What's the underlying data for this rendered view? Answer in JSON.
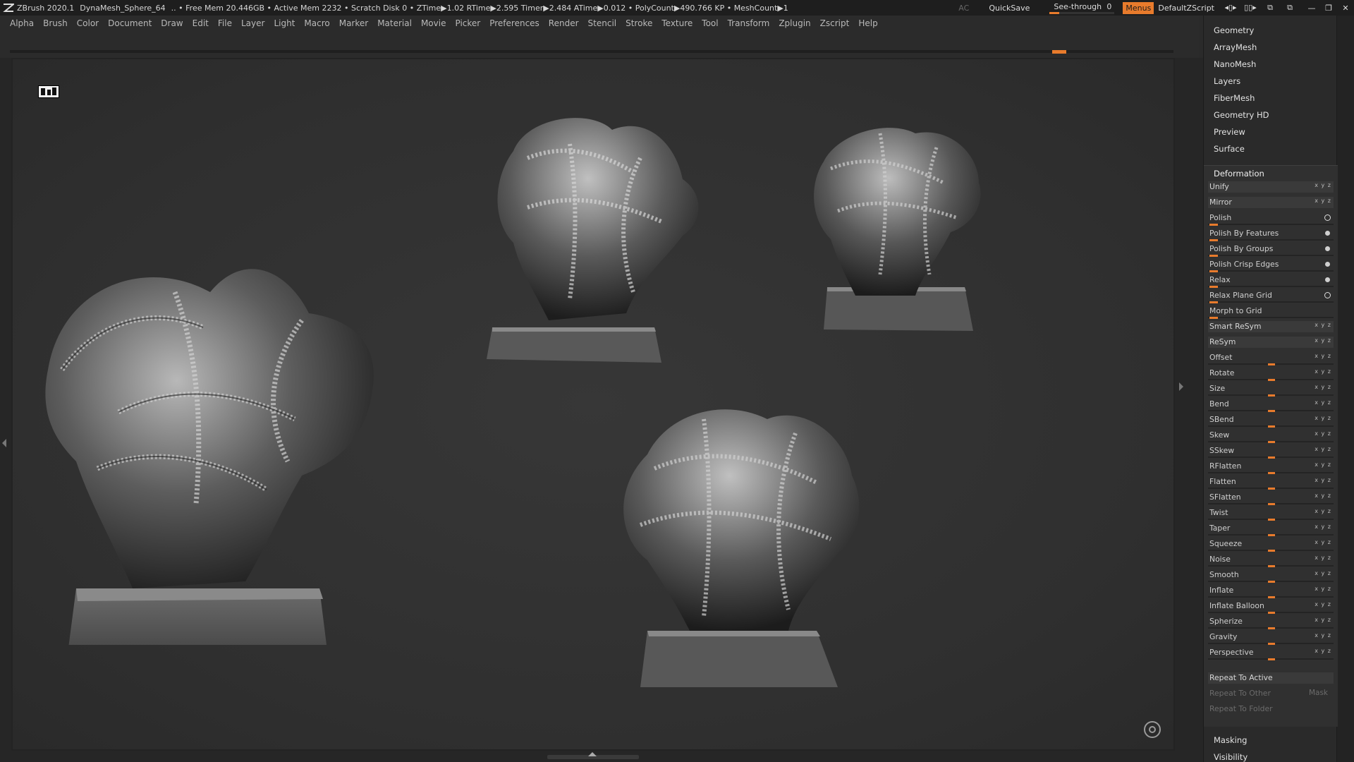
{
  "titlebar": {
    "app": "ZBrush 2020.1",
    "document": "DynaMesh_Sphere_64",
    "stats": ".. • Free Mem 20.446GB • Active Mem 2232 • Scratch Disk 0 •  ZTime▶1.02 RTime▶2.595 Timer▶2.484 ATime▶0.012 • PolyCount▶490.766 KP  • MeshCount▶1",
    "ac": "AC",
    "quicksave": "QuickSave",
    "see_through_label": "See-through",
    "see_through_value": "0",
    "see_through_level": 0.0,
    "menus": "Menus",
    "script": "DefaultZScript",
    "accent": "#e87b2c"
  },
  "menu": [
    "Alpha",
    "Brush",
    "Color",
    "Document",
    "Draw",
    "Edit",
    "File",
    "Layer",
    "Light",
    "Macro",
    "Marker",
    "Material",
    "Movie",
    "Picker",
    "Preferences",
    "Render",
    "Stencil",
    "Stroke",
    "Texture",
    "Tool",
    "Transform",
    "Zplugin",
    "Zscript",
    "Help"
  ],
  "tray": {
    "subpalettes": [
      "Geometry",
      "ArrayMesh",
      "NanoMesh",
      "Layers",
      "FiberMesh",
      "Geometry HD",
      "Preview",
      "Surface"
    ],
    "deformation_title": "Deformation",
    "deformation": [
      {
        "label": "Unify",
        "kind": "button",
        "icons": "xyz"
      },
      {
        "label": "Mirror",
        "kind": "button",
        "icons": "xyz"
      },
      {
        "label": "Polish",
        "kind": "toggle-ring"
      },
      {
        "label": "Polish By Features",
        "kind": "toggle-dot"
      },
      {
        "label": "Polish By Groups",
        "kind": "toggle-dot"
      },
      {
        "label": "Polish Crisp Edges",
        "kind": "toggle-dot"
      },
      {
        "label": "Relax",
        "kind": "toggle-dot"
      },
      {
        "label": "Relax Plane Grid",
        "kind": "toggle-ring"
      },
      {
        "label": "Morph to Grid",
        "kind": "slider"
      },
      {
        "label": "Smart ReSym",
        "kind": "button",
        "icons": "xyz"
      },
      {
        "label": "ReSym",
        "kind": "button",
        "icons": "xyz"
      },
      {
        "label": "Offset",
        "kind": "slider-mid",
        "icons": "xyz"
      },
      {
        "label": "Rotate",
        "kind": "slider-mid",
        "icons": "xyz"
      },
      {
        "label": "Size",
        "kind": "slider-mid",
        "icons": "xyz"
      },
      {
        "label": "Bend",
        "kind": "slider-mid",
        "icons": "xyz"
      },
      {
        "label": "SBend",
        "kind": "slider-mid",
        "icons": "xyz"
      },
      {
        "label": "Skew",
        "kind": "slider-mid",
        "icons": "xyz"
      },
      {
        "label": "SSkew",
        "kind": "slider-mid",
        "icons": "xyz"
      },
      {
        "label": "RFlatten",
        "kind": "slider-mid",
        "icons": "xyz"
      },
      {
        "label": "Flatten",
        "kind": "slider-mid",
        "icons": "xyz"
      },
      {
        "label": "SFlatten",
        "kind": "slider-mid",
        "icons": "xyz"
      },
      {
        "label": "Twist",
        "kind": "slider-mid",
        "icons": "xyz"
      },
      {
        "label": "Taper",
        "kind": "slider-mid",
        "icons": "xyz"
      },
      {
        "label": "Squeeze",
        "kind": "slider-mid",
        "icons": "xyz"
      },
      {
        "label": "Noise",
        "kind": "slider-mid",
        "icons": "xyz"
      },
      {
        "label": "Smooth",
        "kind": "slider-mid",
        "icons": "xyz"
      },
      {
        "label": "Inflate",
        "kind": "slider-mid",
        "icons": "xyz"
      },
      {
        "label": "Inflate Balloon",
        "kind": "slider-mid",
        "icons": "xyz"
      },
      {
        "label": "Spherize",
        "kind": "slider-mid",
        "icons": "xyz"
      },
      {
        "label": "Gravity",
        "kind": "slider-mid",
        "icons": "xyz"
      },
      {
        "label": "Perspective",
        "kind": "slider-mid",
        "icons": "xyz"
      }
    ],
    "repeat_to_active": "Repeat To Active",
    "repeat_to_other": "Repeat To Other",
    "mask": "Mask",
    "repeat_to_folder": "Repeat To Folder",
    "after": [
      "Masking",
      "Visibility"
    ]
  }
}
